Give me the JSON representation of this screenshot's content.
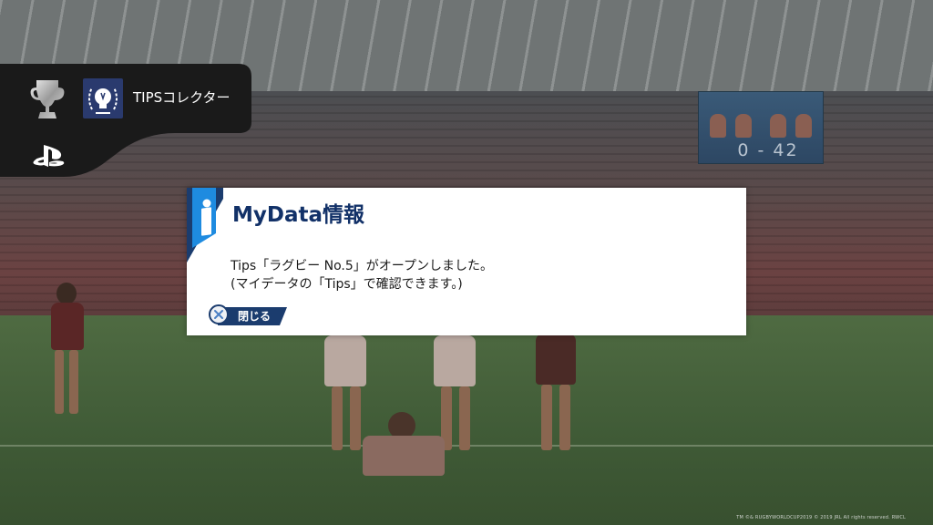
{
  "trophy": {
    "name": "TIPSコレクター",
    "icons": [
      "trophy-icon",
      "trophy-image",
      "playstation-logo-icon"
    ]
  },
  "scoreboard": {
    "score": "0 - 42"
  },
  "dialog": {
    "title": "MyData情報",
    "icon": "info-icon",
    "message_lines": [
      "Tips「ラグビー No.5」がオープンしました。",
      "(マイデータの「Tips」で確認できます。)"
    ],
    "close_label": "閉じる",
    "close_icon": "cross-button-icon"
  },
  "footer": {
    "copyright": "TM ©& RUGBYWORLDCUP2019 © 2019 JRL All rights reserved. RWCL"
  },
  "colors": {
    "accent_blue": "#1b3c6e",
    "info_light_blue": "#1e8be0",
    "dialog_bg": "#ffffff",
    "notification_bg": "#1a1a1a"
  }
}
